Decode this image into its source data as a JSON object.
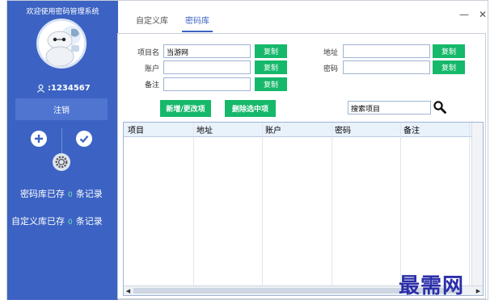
{
  "app": {
    "title": "欢迎使用密码管理系统"
  },
  "user": {
    "name": ":1234567"
  },
  "sidebar": {
    "logout_label": "注销",
    "password_stat_label": "密码库已存",
    "password_stat_count": "0",
    "password_stat_unit": "条记录",
    "custom_stat_label": "自定义库已存",
    "custom_stat_count": "0",
    "custom_stat_unit": "条记录"
  },
  "tabs": [
    {
      "label": "自定义库",
      "active": false
    },
    {
      "label": "密码库",
      "active": true
    }
  ],
  "window": {
    "minimize": "—",
    "close": "✕"
  },
  "form": {
    "project_label": "项目名",
    "project_value": "当游网",
    "account_label": "账户",
    "account_value": "",
    "remark_label": "备注",
    "remark_value": "",
    "address_label": "地址",
    "address_value": "",
    "password_label": "密码",
    "password_value": "",
    "copy_label": "复制",
    "add_update_label": "新增/更改项",
    "delete_label": "删除选中项",
    "search_value": "搜索项目"
  },
  "table": {
    "columns": [
      "项目",
      "地址",
      "账户",
      "密码",
      "备注"
    ],
    "rows": []
  },
  "watermark": "最需网",
  "colors": {
    "sidebar": "#3c63c3",
    "accent_green": "#16b86a",
    "count_green": "#6be6b4"
  }
}
